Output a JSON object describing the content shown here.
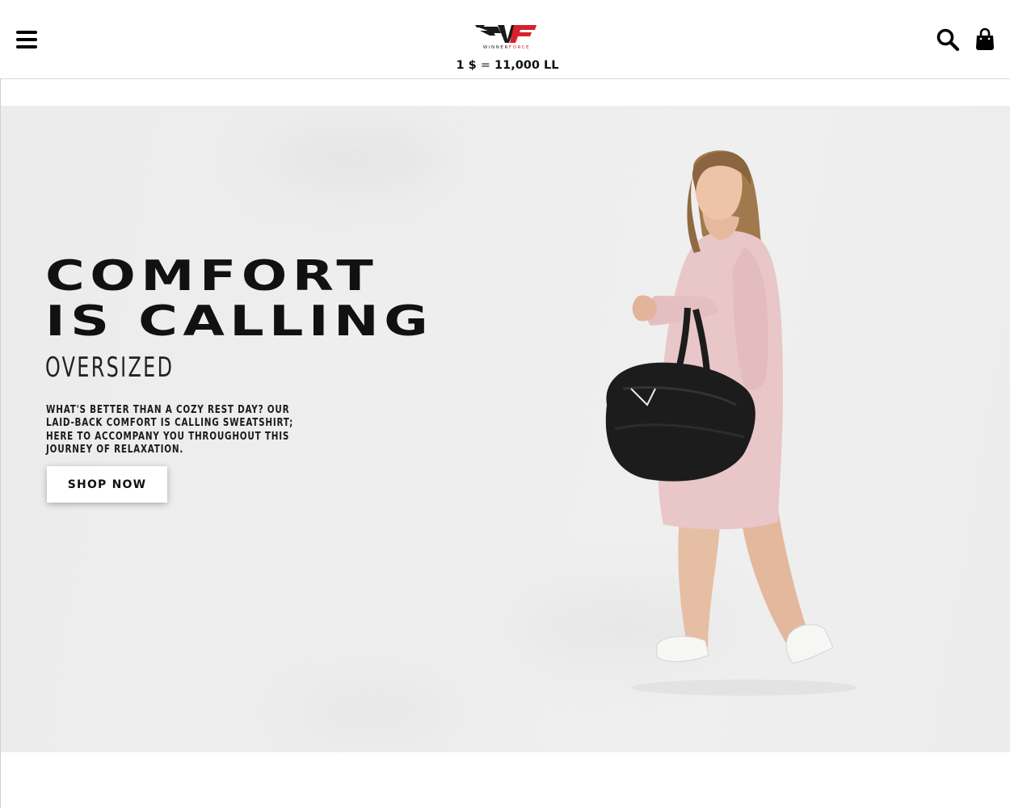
{
  "header": {
    "logo_word_black": "WINNER",
    "logo_word_red": "FORCE",
    "rate_left": "1 $",
    "rate_eq": "=",
    "rate_right": "11,000 LL"
  },
  "icons": {
    "menu": "hamburger-menu-icon",
    "search": "search-icon",
    "cart": "shopping-bag-icon"
  },
  "hero": {
    "headline_line1": "Comfort",
    "headline_line2": "is calling",
    "subhead": "OVERSIZED",
    "description": "What's better than a cozy rest day? Our laid-back Comfort is Calling Sweatshirt; here to accompany you throughout this journey of relaxation.",
    "cta_label": "SHOP NOW"
  },
  "colors": {
    "brand_red": "#d8202b",
    "hero_bg": "#ececec",
    "text": "#111111",
    "sweatshirt_pink": "#e9c6c8",
    "bag_black": "#1c1c1c"
  }
}
